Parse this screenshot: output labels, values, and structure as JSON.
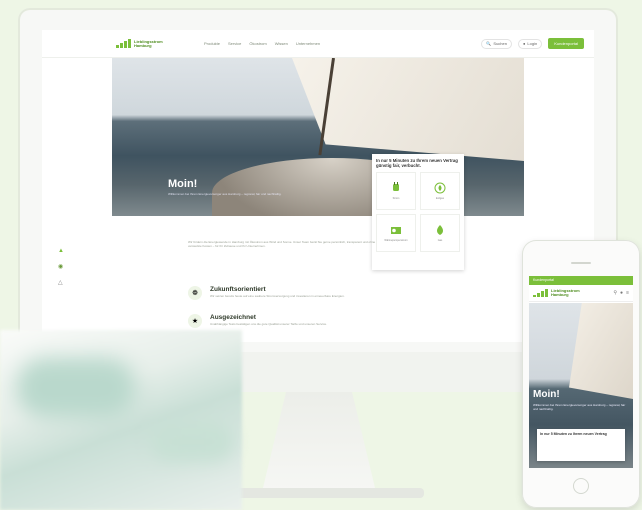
{
  "header": {
    "logo": "Lieblingsstrom Hamburg",
    "nav": [
      "Produkte",
      "Service",
      "Ökostrom",
      "Wissen",
      "Unternehmen"
    ],
    "search_label": "Suchen",
    "login_label": "Login",
    "cta_label": "Kundenportal"
  },
  "hero": {
    "title": "Moin!",
    "subtitle": "Willkommen bei Ihrem Energieversorger aus Hamburg – regional, fair und nachhaltig."
  },
  "quote_card": {
    "title": "In nur 5 Minuten zu Ihrem neuen Vertrag günstig fair, verbucht.",
    "tiles": [
      {
        "label": "Strom",
        "icon": "plug-icon"
      },
      {
        "label": "Erdgas",
        "icon": "flame-person-icon"
      },
      {
        "label": "Wärmepumpenstrom",
        "icon": "heatpump-icon"
      },
      {
        "label": "Gas",
        "icon": "flame-icon"
      }
    ]
  },
  "intro_text": "Wir fördern die Energiewende in Hamburg mit Ökostrom aus Wind und Sonne. Unser Team berät Sie gerne persönlich, transparent und ohne versteckte Kosten – für Ihr Zuhause und Ihr Unternehmen.",
  "features": [
    {
      "title": "Zukunftsorientiert",
      "desc": "Wir setzen bereits heute auf eine saubere Stromversorgung und investieren in erneuerbare Energien.",
      "icon": "leaf-icon"
    },
    {
      "title": "Ausgezeichnet",
      "desc": "Unabhängige Tests bestätigen uns die gute Qualität unserer Tarife und unseren Service.",
      "icon": "award-icon"
    }
  ],
  "side_icons": [
    "thumbs-up-icon",
    "leaf-badge-icon",
    "warning-icon"
  ],
  "phone": {
    "top_bar": "Kundenportal",
    "hero_title": "Moin!",
    "hero_sub": "Willkommen bei Ihrem Energieversorger aus Hamburg – regional, fair und nachhaltig.",
    "card_title": "In nur 5 Minuten zu Ihrem neuen Vertrag"
  },
  "colors": {
    "brand_green": "#7bbf3a",
    "background": "#eef6e6"
  }
}
